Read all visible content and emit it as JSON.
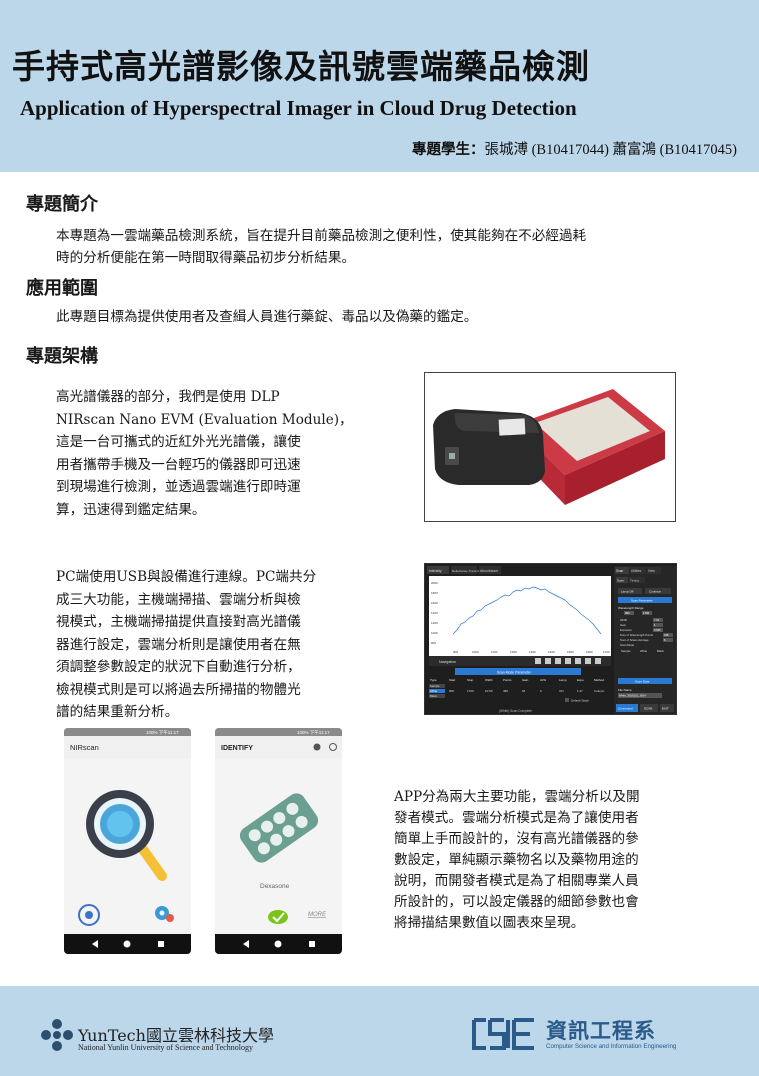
{
  "header": {
    "title_zh": "手持式高光譜影像及訊號雲端藥品檢測",
    "title_en": "Application of Hyperspectral Imager in Cloud Drug Detection",
    "students_label": "專題學生：",
    "students": "張城溥 (B10417044)  蕭富鴻 (B10417045)"
  },
  "sections": {
    "intro": {
      "title": "專題簡介",
      "lines": [
        "本專題為一雲端藥品檢測系統，旨在提升目前藥品檢測之便利性，使其能夠在不必經過耗",
        "時的分析便能在第一時間取得藥品初步分析結果。"
      ]
    },
    "scope": {
      "title": "應用範圍",
      "lines": [
        "此專題目標為提供使用者及查緝人員進行藥錠、毒品以及偽藥的鑑定。"
      ]
    },
    "arch": {
      "title": "專題架構",
      "hw_lines": [
        "高光譜儀器的部分，我們是使用 DLP",
        "NIRscan Nano EVM (Evaluation Module)，",
        "這是一台可攜式的近紅外光光譜儀，讓使",
        "用者攜帶手機及一台輕巧的儀器即可迅速",
        "到現場進行檢測，並透過雲端進行即時運",
        "算，迅速得到鑑定結果。"
      ],
      "pc_lines": [
        "PC端使用USB與設備進行連線。PC端共分",
        "成三大功能，主機端掃描、雲端分析與檢",
        "視模式，主機端掃描提供直接對高光譜儀",
        "器進行設定，雲端分析則是讓使用者在無",
        "須調整參數設定的狀況下自動進行分析，",
        "檢視模式則是可以將過去所掃描的物體光",
        "譜的結果重新分析。"
      ],
      "app_lines": [
        "APP分為兩大主要功能，雲端分析以及開",
        "發者模式。雲端分析模式是為了讓使用者",
        "簡單上手而設計的，沒有高光譜儀器的參",
        "數設定，單純顯示藥物名以及藥物用途的",
        "說明，而開發者模式是為了相關專業人員",
        "所設計的，可以設定儀器的細節參數也會",
        "將掃描結果數值以圖表來呈現。"
      ]
    }
  },
  "gui": {
    "tabs": [
      "Intensity",
      "Reflectance Transmittance",
      "Absorbance"
    ],
    "side_tabs": [
      "Scan",
      "Utilities",
      "View"
    ],
    "side_sub": [
      "Scan",
      "Timing"
    ],
    "lamp_buttons": [
      "Lamp Off",
      "Continue"
    ],
    "scan_param_button": "Scan Parameter",
    "wavelength_range": "Wavelength Range",
    "wl_values": [
      "900",
      "1700"
    ],
    "side_fields": [
      {
        "label": "Width",
        "value": "7.03"
      },
      {
        "label": "Gain",
        "value": "1"
      },
      {
        "label": "Exposure",
        "value": "0.635"
      },
      {
        "label": "Num of Wavelength Points",
        "value": "228"
      },
      {
        "label": "Num of Scans Average",
        "value": "6"
      },
      {
        "label": "Scan Mode",
        "value": ""
      }
    ],
    "scan_modes": [
      "Sample",
      "White",
      "Black"
    ],
    "navigation": "Navigation",
    "scan_params_button": "Scan Mode Parameter",
    "table_headers": [
      "Type",
      "Start",
      "Stop",
      "Width",
      "Points",
      "Gain",
      "AVG",
      "Lamp",
      "Expo",
      "Method"
    ],
    "table_types": [
      "Sample",
      "White",
      "Black"
    ],
    "table_row": [
      "900",
      "1700",
      "10.50",
      "480",
      "64",
      "6",
      "ON",
      "1.27",
      "Column"
    ],
    "default_stack": "Default Stack",
    "status": "(White) Scan Complete",
    "store_data": "Store Data",
    "file_name_label": "File Name",
    "file_name": "White_20181101_0914",
    "bottom_buttons": [
      "Connected",
      "SCAN",
      "EXIT"
    ],
    "y_ticks": [
      "2000",
      "1800",
      "1600",
      "1400",
      "1200",
      "1000",
      "800"
    ],
    "x_ticks": [
      "900",
      "1000",
      "1100",
      "1200",
      "1300",
      "1400",
      "1500",
      "1600",
      "1700"
    ]
  },
  "phones": {
    "left": {
      "status": "100% 下午11:17",
      "app_title": "NIRscan"
    },
    "right": {
      "status": "100% 下午11:17",
      "app_title": "IDENTIFY",
      "drug": "Dexasone",
      "more": "MORE"
    }
  },
  "footer": {
    "yuntech_name": "YunTech國立雲林科技大學",
    "yuntech_sub": "National Yunlin University of Science and Technology",
    "csie_logo": "CSIE",
    "csie_name": "資訊工程系",
    "csie_sub": "Computer Science and Information Engineering"
  },
  "colors": {
    "band": "#bcd6ea",
    "accent_blue": "#2a7ad4",
    "pill_teal": "#6a9f92",
    "check_green": "#7ac41a"
  }
}
